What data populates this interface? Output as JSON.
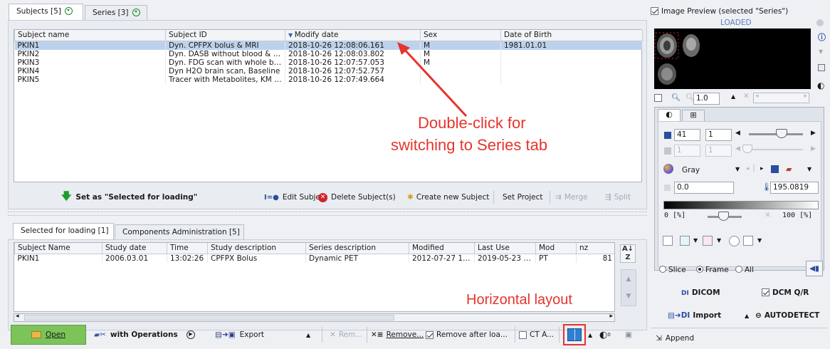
{
  "top_tabs": [
    {
      "label": "Subjects [5]"
    },
    {
      "label": "Series [3]"
    }
  ],
  "subjects": {
    "columns": [
      "Subject name",
      "Subject ID",
      "Modify date",
      "Sex",
      "Date of Birth"
    ],
    "rows": [
      [
        "PKIN1",
        "Dyn. CPFPX bolus & MRI",
        "2018-10-26 12:08:06.161",
        "M",
        "1981.01.01"
      ],
      [
        "PKIN2",
        "Dyn. DASB without blood & MRI",
        "2018-10-26 12:08:03.802",
        "M",
        ""
      ],
      [
        "PKIN3",
        "Dyn. FDG scan with whole blo...",
        "2018-10-26 12:07:57.053",
        "M",
        ""
      ],
      [
        "PKIN4",
        "Dyn H2O brain scan, Baseline",
        "2018-10-26 12:07:52.757",
        "",
        ""
      ],
      [
        "PKIN5",
        "Tracer with Metabolites, KM Fil...",
        "2018-10-26 12:07:49.664",
        "",
        ""
      ]
    ],
    "set_selected": "Set as \"Selected for loading\"",
    "edit_subject": "Edit Subject",
    "delete_subjects": "Delete Subject(s)",
    "create_subject": "Create new Subject",
    "set_project": "Set Project",
    "merge": "Merge",
    "split": "Split"
  },
  "annotation_top": {
    "line1": "Double-click for",
    "line2": "switching to Series tab"
  },
  "annotation_bottom": "Horizontal layout",
  "bottom_tabs": [
    {
      "label": "Selected for loading [1]"
    },
    {
      "label": "Components Administration [5]"
    }
  ],
  "loading": {
    "columns": [
      "Subject Name",
      "Study date",
      "Time",
      "Study description",
      "Series description",
      "Modified",
      "Last Use",
      "Mod",
      "nz"
    ],
    "rows": [
      [
        "PKIN1",
        "2006.03.01",
        "13:02:26",
        "CPFPX Bolus",
        "Dynamic PET",
        "2012-07-27 11...",
        "2019-05-23 11...",
        "PT",
        "81"
      ]
    ]
  },
  "toolbar": {
    "open": "Open",
    "with_operations": "with Operations",
    "export": "Export",
    "remove_short": "Rem...",
    "remove": "Remove...",
    "remove_after": "Remove after loa...",
    "ct_a": "CT A..."
  },
  "right": {
    "preview_label": "Image Preview (selected \"Series\")",
    "status": "LOADED",
    "zoom": "1.0",
    "tab1_icon": "contrast-icon",
    "tab2_icon": "grid-icon",
    "slice_value": "41",
    "frame_value": "1",
    "frame2_value": "1",
    "frame3_value": "1",
    "colormap": "Gray",
    "min_value": "0.0",
    "max_value": "195.0819",
    "range_left": "0 [%]",
    "range_right": "100 [%]",
    "mode_slice": "Slice",
    "mode_frame": "Frame",
    "mode_all": "All",
    "dicom": "DICOM",
    "dcm_qr": "DCM Q/R",
    "import": "Import",
    "autodetect": "AUTODETECT",
    "append": "Append"
  }
}
